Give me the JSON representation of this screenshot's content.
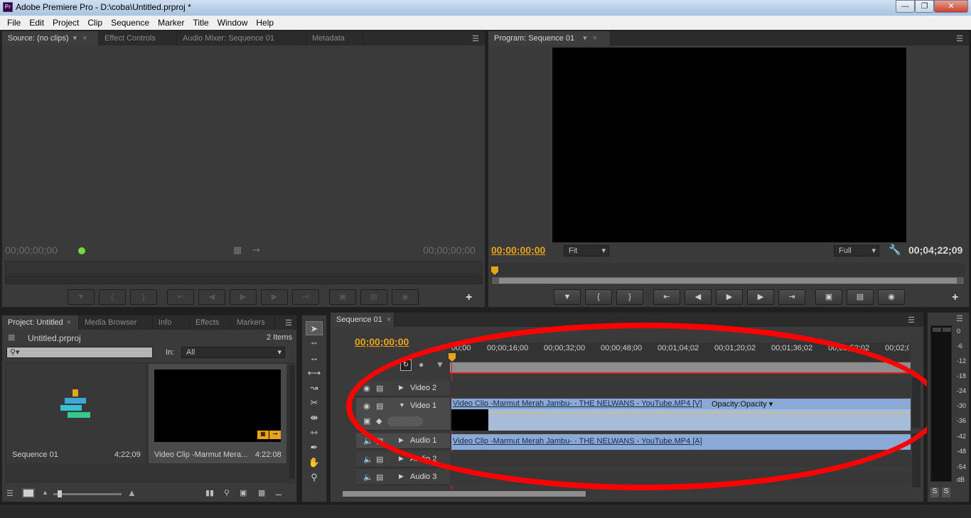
{
  "window": {
    "title": "Adobe Premiere Pro - D:\\coba\\Untitled.prproj *",
    "logo": "Pr"
  },
  "menu": [
    "File",
    "Edit",
    "Project",
    "Clip",
    "Sequence",
    "Marker",
    "Title",
    "Window",
    "Help"
  ],
  "source": {
    "tabs": [
      "Source: (no clips)",
      "Effect Controls",
      "Audio Mixer: Sequence 01",
      "Metadata"
    ],
    "tc_in": "00;00;00;00",
    "tc_out": "00;00;00;00"
  },
  "program": {
    "tab": "Program: Sequence 01",
    "tc_current": "00;00;00;00",
    "tc_duration": "00;04;22;09",
    "fit": "Fit",
    "quality": "Full"
  },
  "project": {
    "tabs": [
      "Project: Untitled",
      "Media Browser",
      "Info",
      "Effects",
      "Markers"
    ],
    "file": "Untitled.prproj",
    "count": "2 Items",
    "in_label": "In:",
    "in_value": "All",
    "items": [
      {
        "name": "Sequence 01",
        "duration": "4;22;09"
      },
      {
        "name": "Video Clip -Marmut Mera...",
        "duration": "4:22:08"
      }
    ]
  },
  "sequence": {
    "tab": "Sequence 01",
    "timecode": "00;00;00;00",
    "ruler": [
      "00;00",
      "00;00;16;00",
      "00;00;32;00",
      "00;00;48;00",
      "00;01;04;02",
      "00;01;20;02",
      "00;01;36;02",
      "00;01;52;02",
      "00;02;0"
    ],
    "tracks": {
      "v2": "Video 2",
      "v1": "Video 1",
      "a1": "Audio 1",
      "a2": "Audio 2",
      "a3": "Audio 3"
    },
    "video_clip": "Video Clip -Marmut Merah Jambu- - THE NELWANS - YouTube.MP4 [V]",
    "opacity": "Opacity:Opacity",
    "audio_clip": "Video Clip -Marmut Merah Jambu- - THE NELWANS - YouTube.MP4 [A]"
  },
  "meter": {
    "labels": [
      "0",
      "-6",
      "-12",
      "-18",
      "-24",
      "-30",
      "-36",
      "-42",
      "-48",
      "-54",
      "dB"
    ],
    "solo": [
      "S",
      "S"
    ]
  },
  "colors": {
    "timecode": "#e8a317",
    "annotation": "#ff0000",
    "clip": "#a7bcd9"
  }
}
